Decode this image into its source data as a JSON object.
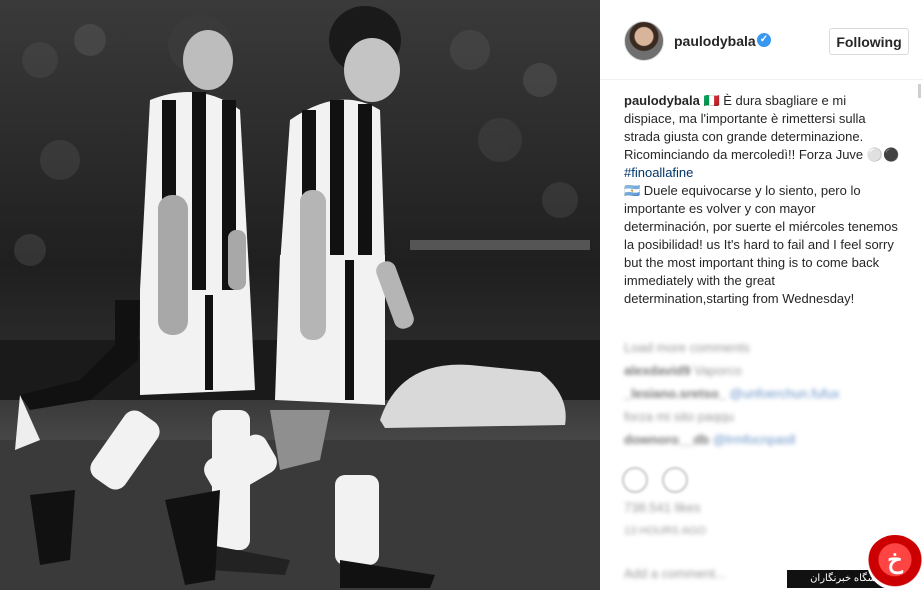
{
  "post": {
    "image_alt": "",
    "header": {
      "username": "paulodybala",
      "verified_icon": "verified-badge-icon",
      "follow_label": "Following"
    },
    "caption": {
      "username": "paulodybala",
      "line_1": " 🇮🇹 È dura sbagliare e mi dispiace, ma l'importante è rimettersi sulla strada giusta con grande determinazione. Ricominciando da mercoledì!! Forza Juve ⚪⚫ ",
      "hashtag": "#finoallafine",
      "line_2": "🇦🇷 Duele equivocarse y lo siento, pero lo importante es volver y con mayor determinación, por suerte el miércoles tenemos la posibilidad! us It's hard to fail and I feel sorry but the most important thing is to come back immediately with the great determination,starting from Wednesday!"
    },
    "comments": [
      {
        "text": "Load more comments"
      },
      {
        "user": "alexdavid9",
        "text": "Vaporco"
      },
      {
        "user": "_lesiano.sretso_",
        "tag": "@unfoerchun.fufux"
      },
      {
        "text": "forza mi sito paqqu"
      },
      {
        "user": "downoro__db",
        "tag": "@lrmfocnpasll"
      }
    ],
    "actions": {
      "like_icon": "heart-icon",
      "comment_icon": "comment-icon"
    },
    "likes": "738.541 likes",
    "time": "13 HOURS AGO",
    "add_comment_placeholder": "Add a comment..."
  },
  "watermark": {
    "text": "باشگاه خبرنگاران",
    "logo_glyph": "خ"
  },
  "colors": {
    "accent": "#3897f0",
    "link": "#003569",
    "border": "#dbdbdb"
  }
}
